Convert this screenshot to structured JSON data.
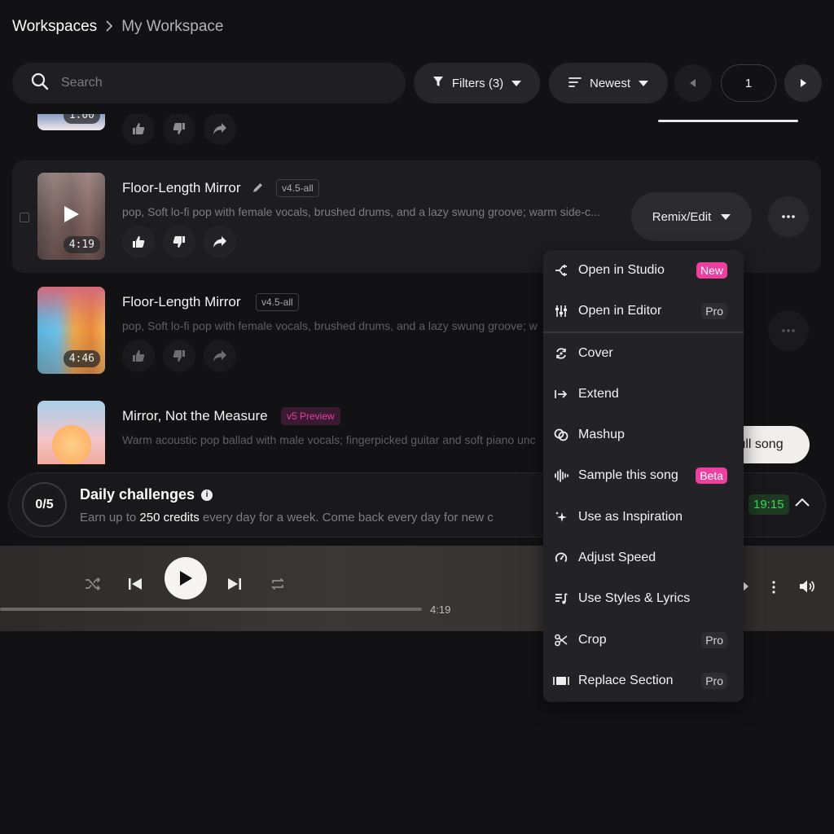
{
  "breadcrumb": {
    "root": "Workspaces",
    "separator": ">",
    "current": "My Workspace"
  },
  "search": {
    "placeholder": "Search",
    "value": ""
  },
  "filters": {
    "label": "Filters (3)"
  },
  "sort": {
    "label": "Newest"
  },
  "pagination": {
    "page": "1"
  },
  "songs": [
    {
      "title": "",
      "duration": "1:00"
    },
    {
      "title": "Floor-Length Mirror",
      "version": "v4.5-all",
      "description": "pop, Soft lo-fi pop with female vocals, brushed drums, and a lazy swung groove; warm side-c...",
      "duration": "4:19"
    },
    {
      "title": "Floor-Length Mirror",
      "version": "v4.5-all",
      "description": "pop, Soft lo-fi pop with female vocals, brushed drums, and a lazy swung groove; w",
      "duration": "4:46"
    },
    {
      "title": "Mirror, Not the Measure",
      "version": "v5 Preview",
      "description": "Warm acoustic pop ballad with male vocals; fingerpicked guitar and soft piano unc"
    }
  ],
  "remix": {
    "label": "Remix/Edit"
  },
  "full_song": {
    "label": "full song"
  },
  "challenge": {
    "progress": "0/5",
    "title": "Daily challenges",
    "desc_prefix": "Earn up to ",
    "desc_credits": "250 credits",
    "desc_suffix": " every day for a week. Come back every day for new c",
    "timer": "19:15"
  },
  "player": {
    "time": "4:19"
  },
  "menu": {
    "items": [
      {
        "label": "Open in Studio",
        "tag": "New",
        "icon": "studio-icon"
      },
      {
        "label": "Open in Editor",
        "tag": "Pro",
        "icon": "sliders-icon"
      },
      {
        "label": "Cover",
        "tag": "",
        "icon": "cover-icon"
      },
      {
        "label": "Extend",
        "tag": "",
        "icon": "extend-icon"
      },
      {
        "label": "Mashup",
        "tag": "",
        "icon": "mashup-icon"
      },
      {
        "label": "Sample this song",
        "tag": "Beta",
        "icon": "waveform-icon"
      },
      {
        "label": "Use as Inspiration",
        "tag": "",
        "icon": "sparkle-icon"
      },
      {
        "label": "Adjust Speed",
        "tag": "",
        "icon": "speed-icon"
      },
      {
        "label": "Use Styles & Lyrics",
        "tag": "",
        "icon": "lyrics-icon"
      },
      {
        "label": "Crop",
        "tag": "Pro",
        "icon": "scissors-icon"
      },
      {
        "label": "Replace Section",
        "tag": "Pro",
        "icon": "replace-icon"
      }
    ]
  },
  "colors": {
    "background": "#121114",
    "accent_pink": "#ec3f9e",
    "timer_green": "#3ed45a"
  }
}
